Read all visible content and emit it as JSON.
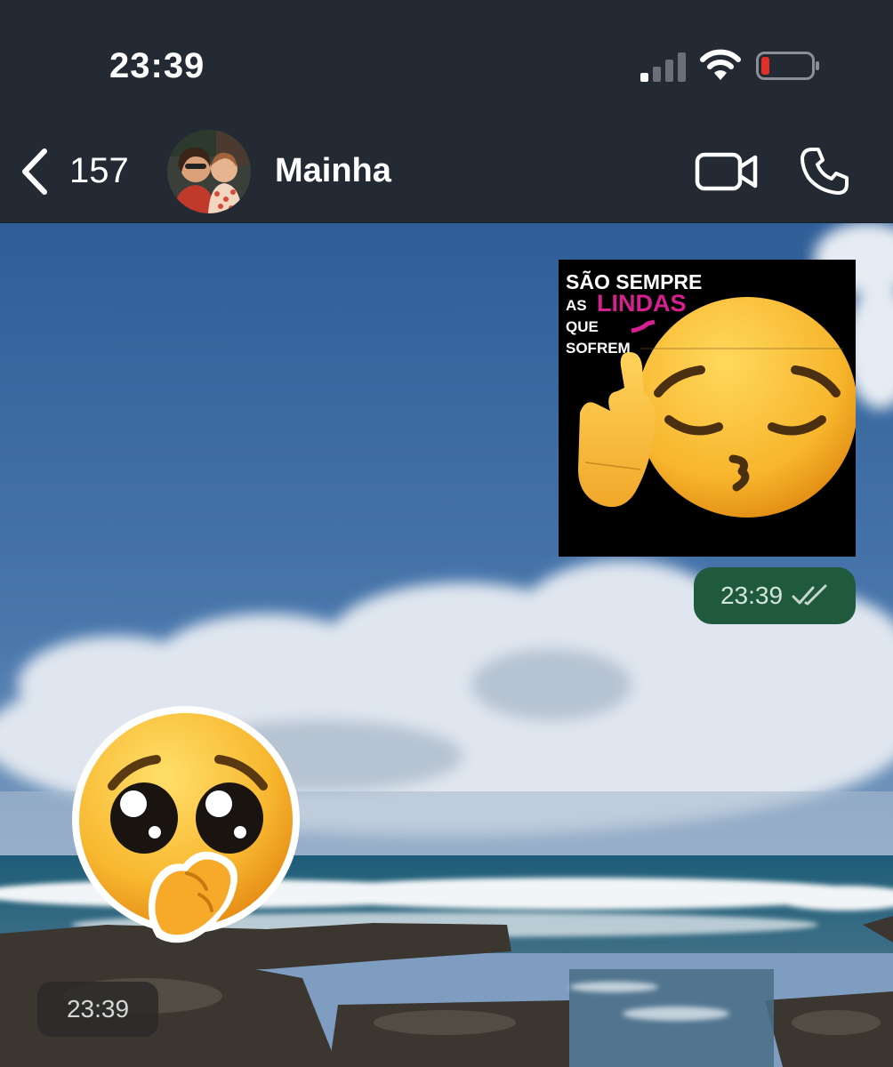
{
  "status_bar": {
    "time": "23:39",
    "signal": "cell-signal-icon",
    "wifi": "wifi-icon",
    "battery": "low-battery-icon"
  },
  "header": {
    "back_icon": "chevron-left-icon",
    "unread_count": "157",
    "contact_name": "Mainha",
    "avatar": "contact-avatar-photo",
    "video_icon": "video-camera-icon",
    "call_icon": "phone-icon"
  },
  "messages": [
    {
      "direction": "outgoing",
      "type": "sticker",
      "sticker_text": {
        "line1": "SÃO SEMPRE",
        "as": "AS",
        "lindas": "LINDAS",
        "que": "QUE",
        "sofrem": "SOFREM"
      },
      "time": "23:39",
      "read_icon": "double-check-icon"
    },
    {
      "direction": "incoming",
      "type": "sticker",
      "emoji": "pleading-face-icon",
      "time": "23:39"
    }
  ],
  "colors": {
    "header_bg": "#232a33",
    "outgoing_time_bg": "#1f5a3d",
    "lindas_text": "#d6208f",
    "battery_low": "#e0302a"
  }
}
